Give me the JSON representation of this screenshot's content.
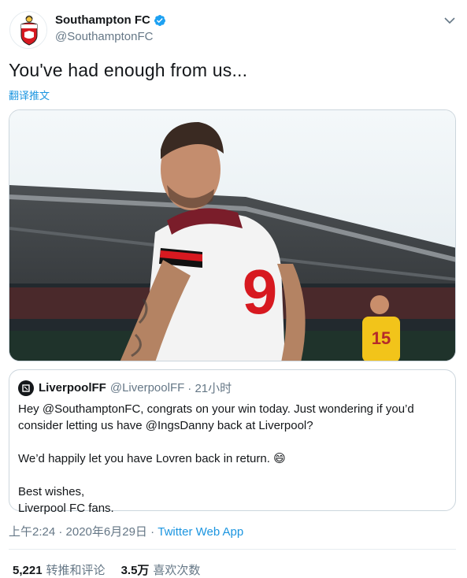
{
  "author": {
    "display_name": "Southampton FC",
    "handle": "@SouthamptonFC",
    "verified_icon": "verified-badge-icon",
    "avatar_icon": "club-crest-icon"
  },
  "tweet": {
    "text": "You've had enough from us...",
    "translate_label": "翻译推文"
  },
  "media": {
    "alt": "Player in number 9 shirt looking back over shoulder in stadium",
    "shirt_number": "9",
    "bg_player_number": "15"
  },
  "quote": {
    "display_name": "LiverpoolFF",
    "handle": "@LiverpoolFF",
    "time": "· 21小时",
    "lines": [
      "Hey @SouthamptonFC, congrats on your win today. Just wondering if you’d consider letting us have @IngsDanny back at Liverpool?",
      "We’d happily let you have Lovren back in return. 😄",
      "Best wishes,",
      "Liverpool FC fans."
    ]
  },
  "meta": {
    "timestamp": "上午2:24 · 2020年6月29日 · ",
    "app": "Twitter Web App"
  },
  "stats": {
    "retweets_count": "5,221",
    "retweets_label": "转推和评论",
    "likes_count": "3.5万",
    "likes_label": "喜欢次数"
  },
  "colors": {
    "link": "#1b95e0",
    "muted": "#657786",
    "text": "#14171a"
  }
}
